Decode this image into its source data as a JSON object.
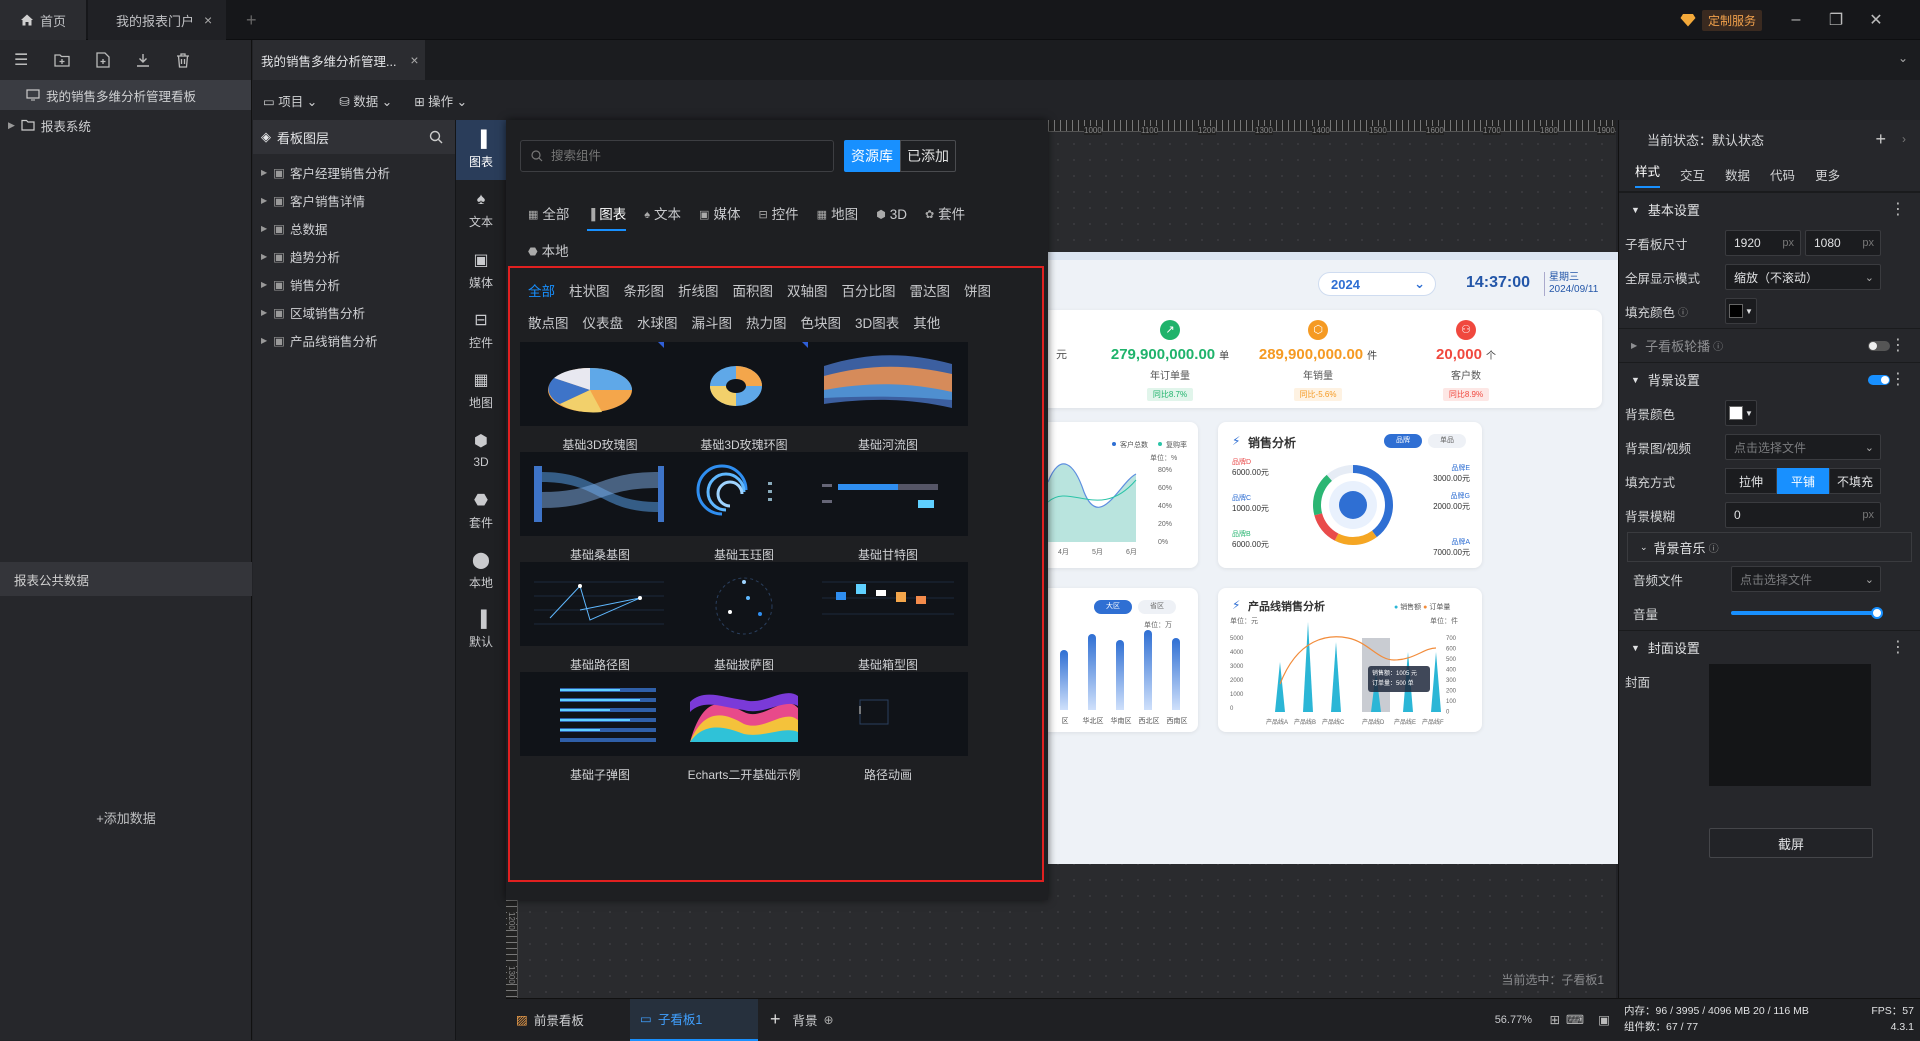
{
  "titlebar": {
    "home_tab": "首页",
    "portal_tab": "我的报表门户",
    "custom_service": "定制服务"
  },
  "project_tab": "我的销售多维分析管理...",
  "left_panel": {
    "dashboard_item": "我的销售多维分析管理看板",
    "report_system": "报表系统",
    "public_data_title": "报表公共数据",
    "add_data": "+添加数据"
  },
  "menu": {
    "project": "项目",
    "data": "数据",
    "operate": "操作"
  },
  "layers": {
    "title": "看板图层",
    "items": [
      "客户经理销售分析",
      "客户销售详情",
      "总数据",
      "趋势分析",
      "销售分析",
      "区域销售分析",
      "产品线销售分析"
    ]
  },
  "categories": [
    "图表",
    "文本",
    "媒体",
    "控件",
    "地图",
    "3D",
    "套件",
    "本地",
    "默认"
  ],
  "popup": {
    "search_placeholder": "搜索组件",
    "resource_btn": "资源库",
    "added_btn": "已添加",
    "top_tabs": [
      "全部",
      "图表",
      "文本",
      "媒体",
      "控件",
      "地图",
      "3D",
      "套件",
      "本地"
    ],
    "active_top_tab": "图表",
    "sub_tabs": [
      "全部",
      "柱状图",
      "条形图",
      "折线图",
      "面积图",
      "双轴图",
      "百分比图",
      "雷达图",
      "饼图",
      "散点图",
      "仪表盘",
      "水球图",
      "漏斗图",
      "热力图",
      "色块图",
      "3D图表",
      "其他"
    ],
    "cards": [
      "基础3D玫瑰图",
      "基础3D玫瑰环图",
      "基础河流图",
      "基础桑基图",
      "基础玉珏图",
      "基础甘特图",
      "基础路径图",
      "基础披萨图",
      "基础箱型图",
      "基础子弹图",
      "Echarts二开基础示例",
      "路径动画"
    ],
    "badge": "基"
  },
  "ruler": {
    "labels": [
      "1000",
      "1100",
      "1200",
      "1300",
      "1400",
      "1500",
      "1600",
      "1700",
      "1800",
      "1900"
    ],
    "vlabels": [
      "1200",
      "1300"
    ]
  },
  "board": {
    "year": "2024",
    "time": "14:37:00",
    "weekday": "星期三",
    "date": "2024/09/11",
    "unit_yuan": "元",
    "kpis": [
      {
        "value": "279,900,000.00",
        "unit": "单",
        "label": "年订单量",
        "trend": "同比8.7%",
        "color": "#1fb36b"
      },
      {
        "value": "289,900,000.00",
        "unit": "件",
        "label": "年销量",
        "trend": "同比-5.6%",
        "color": "#f59a23"
      },
      {
        "value": "20,000",
        "unit": "个",
        "label": "客户数",
        "trend": "同比8.9%",
        "color": "#f0483e"
      }
    ],
    "trend_legend": [
      "客户总数",
      "复购率"
    ],
    "trend_unit": "单位：%",
    "trend_pcts": [
      "80%",
      "60%",
      "40%",
      "20%",
      "0%"
    ],
    "trend_months": [
      "4月",
      "5月",
      "6月"
    ],
    "sales_title": "销售分析",
    "sales_tabs": [
      "品牌",
      "单品"
    ],
    "brands": [
      {
        "name": "品牌D",
        "value": "6000.00元"
      },
      {
        "name": "品牌C",
        "value": "1000.00元"
      },
      {
        "name": "品牌B",
        "value": "6000.00元"
      },
      {
        "name": "品牌E",
        "value": "3000.00元"
      },
      {
        "name": "品牌G",
        "value": "2000.00元"
      },
      {
        "name": "品牌A",
        "value": "7000.00元"
      }
    ],
    "region_tabs": [
      "大区",
      "省区"
    ],
    "region_unit": "单位：万",
    "regions": [
      "区",
      "华北区",
      "华南区",
      "西北区",
      "西南区"
    ],
    "product_title": "产品线销售分析",
    "product_legend": [
      "销售额",
      "订单量"
    ],
    "product_unit_left": "单位：元",
    "product_unit_right": "单位：件",
    "product_y_left": [
      "5000",
      "4000",
      "3000",
      "2000",
      "1000",
      "0"
    ],
    "product_y_right": [
      "700",
      "600",
      "500",
      "400",
      "300",
      "200",
      "100",
      "0"
    ],
    "products": [
      "产品线A",
      "产品线B",
      "产品线C",
      "产品线D",
      "产品线E",
      "产品线F"
    ],
    "tooltip_sales": "销售额：1005 元",
    "tooltip_orders": "订单量：500 单"
  },
  "current_selected": "当前选中：子看板1",
  "bottom": {
    "front_board": "前景看板",
    "sub_board": "子看板1",
    "background": "背景",
    "zoom": "56.77%",
    "memory": "内存：96 / 3995 / 4096 MB 20 / 116 MB",
    "components": "组件数：67 / 77",
    "fps": "FPS：57",
    "version": "4.3.1"
  },
  "right_panel": {
    "state": "当前状态：默认状态",
    "tabs": [
      "样式",
      "交互",
      "数据",
      "代码",
      "更多"
    ],
    "basic": "基本设置",
    "size_label": "子看板尺寸",
    "width": "1920",
    "height": "1080",
    "px": "px",
    "fullscreen_label": "全屏显示模式",
    "fullscreen_value": "缩放（不滚动）",
    "fill_color_label": "填充颜色",
    "carousel": "子看板轮播",
    "bg_section": "背景设置",
    "bg_color_label": "背景颜色",
    "bg_media_label": "背景图/视频",
    "choose_file": "点击选择文件",
    "fill_mode_label": "填充方式",
    "fill_modes": [
      "拉伸",
      "平铺",
      "不填充"
    ],
    "active_fill_mode": "平铺",
    "bg_blur_label": "背景模糊",
    "bg_blur_value": "0",
    "music_section": "背景音乐",
    "audio_label": "音频文件",
    "volume_label": "音量",
    "volume": 1.0,
    "cover_section": "封面设置",
    "cover_label": "封面",
    "screenshot_btn": "截屏"
  },
  "colors": {
    "accent": "#1890ff",
    "highlight_border": "#e02020"
  }
}
